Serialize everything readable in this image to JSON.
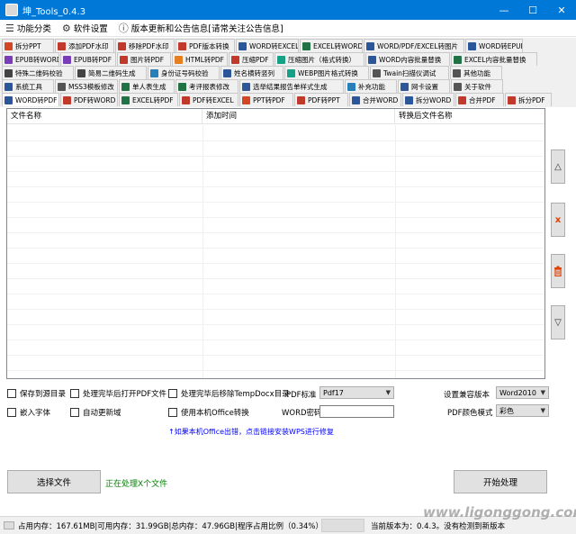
{
  "window": {
    "title": "坤_Tools_0.4.3",
    "controls": [
      "—",
      "☐",
      "✕"
    ]
  },
  "menu": [
    {
      "label": "功能分类",
      "icon": "list-icon"
    },
    {
      "label": "软件设置",
      "icon": "gear-icon"
    },
    {
      "label": "版本更新和公告信息[请常关注公告信息]",
      "icon": "info-icon"
    }
  ],
  "tab_rows": [
    [
      {
        "label": "拆分PPT",
        "color": "#d24726",
        "w": 58
      },
      {
        "label": "添加PDF水印",
        "color": "#c0392b",
        "w": 66
      },
      {
        "label": "移除PDF水印",
        "color": "#c0392b",
        "w": 66
      },
      {
        "label": "PDF版本转换",
        "color": "#c0392b",
        "w": 66
      },
      {
        "label": "WORD转EXCEL",
        "color": "#2b579a",
        "w": 70
      },
      {
        "label": "EXCEL转WORD",
        "color": "#217346",
        "w": 70
      },
      {
        "label": "WORD/PDF/EXCEL转图片",
        "color": "#2b579a",
        "w": 112
      },
      {
        "label": "WORD转EPUB",
        "color": "#2b579a",
        "w": 64
      }
    ],
    [
      {
        "label": "EPUB转WORD",
        "color": "#7a3db8",
        "w": 64
      },
      {
        "label": "EPUB转PDF",
        "color": "#7a3db8",
        "w": 62
      },
      {
        "label": "图片转PDF",
        "color": "#c0392b",
        "w": 60
      },
      {
        "label": "HTML转PDF",
        "color": "#e67e22",
        "w": 62
      },
      {
        "label": "压缩PDF",
        "color": "#c0392b",
        "w": 50
      },
      {
        "label": "压缩图片（格式转换）",
        "color": "#16a085",
        "w": 100
      },
      {
        "label": "WORD内容批量替换",
        "color": "#2b579a",
        "w": 94
      },
      {
        "label": "EXCEL内容批量替换",
        "color": "#217346",
        "w": 96
      }
    ],
    [
      {
        "label": "特殊二维码校验",
        "color": "#444444",
        "w": 80
      },
      {
        "label": "简易二维码生成",
        "color": "#444444",
        "w": 80
      },
      {
        "label": "身份证号码校验",
        "color": "#2980b9",
        "w": 80
      },
      {
        "label": "姓名横转竖列",
        "color": "#2b579a",
        "w": 70
      },
      {
        "label": "WEBP图片格式转换",
        "color": "#16a085",
        "w": 94
      },
      {
        "label": "Twain扫描仪调试",
        "color": "#555555",
        "w": 88
      },
      {
        "label": "其他功能",
        "color": "#555555",
        "w": 58
      }
    ],
    [
      {
        "label": "系统工具",
        "color": "#2b579a",
        "w": 58
      },
      {
        "label": "MSS3模板修改",
        "color": "#555555",
        "w": 70
      },
      {
        "label": "单人表生成",
        "color": "#217346",
        "w": 62
      },
      {
        "label": "考评报表修改",
        "color": "#217346",
        "w": 70
      },
      {
        "label": "选举结果报告单样式生成",
        "color": "#2b579a",
        "w": 116
      },
      {
        "label": "补充功能",
        "color": "#2980b9",
        "w": 58
      },
      {
        "label": "网卡设置",
        "color": "#2b579a",
        "w": 58
      },
      {
        "label": "关于软件",
        "color": "#555555",
        "w": 58
      }
    ],
    [
      {
        "label": "WORD转PDF",
        "color": "#2b579a",
        "w": 64,
        "active": true
      },
      {
        "label": "PDF转WORD",
        "color": "#c0392b",
        "w": 64
      },
      {
        "label": "EXCEL转PDF",
        "color": "#217346",
        "w": 66
      },
      {
        "label": "PDF转EXCEL",
        "color": "#c0392b",
        "w": 66
      },
      {
        "label": "PPT转PDF",
        "color": "#d24726",
        "w": 60
      },
      {
        "label": "PDF转PPT",
        "color": "#c0392b",
        "w": 60
      },
      {
        "label": "合并WORD",
        "color": "#2b579a",
        "w": 58
      },
      {
        "label": "拆分WORD",
        "color": "#2b579a",
        "w": 58
      },
      {
        "label": "合并PDF",
        "color": "#c0392b",
        "w": 54
      },
      {
        "label": "拆分PDF",
        "color": "#c0392b",
        "w": 52
      }
    ]
  ],
  "grid": {
    "columns": [
      "文件名称",
      "添加时间",
      "转换后文件名称"
    ]
  },
  "side_buttons": [
    {
      "glyph": "△",
      "name": "move-up-button"
    },
    {
      "glyph": "x",
      "name": "remove-item-button",
      "color": "#e04000"
    },
    {
      "glyph": "🗑",
      "name": "clear-list-button",
      "color": "#e04000"
    },
    {
      "glyph": "▽",
      "name": "move-down-button"
    }
  ],
  "options": {
    "save_to_source": "保存到源目录",
    "open_after": "处理完毕后打开PDF文件",
    "move_after": "处理完毕后移除TempDocx目录",
    "embed_fonts": "嵌入字体",
    "auto_update": "自动更新域",
    "use_office": "使用本机Office转换",
    "pdf_standard_label": "PDF标准",
    "pdf_standard_value": "Pdf17",
    "word_password_label": "WORD密码",
    "compat_label": "设置兼容版本",
    "compat_value": "Word2010",
    "color_mode_label": "PDF颜色模式",
    "color_mode_value": "彩色"
  },
  "office_link": "↑如果本机Office出错，点击链接安装WPS进行修复",
  "buttons": {
    "select_file": "选择文件",
    "start": "开始处理"
  },
  "processing_status": "正在处理X个文件",
  "statusbar": {
    "memory": "占用内存：167.61MB|可用内存：31.99GB|总内存：47.96GB|程序占用比例（0.34%）",
    "version": "当前版本为：0.4.3。没有检测到新版本"
  },
  "watermark": "www.ligonggong.com"
}
